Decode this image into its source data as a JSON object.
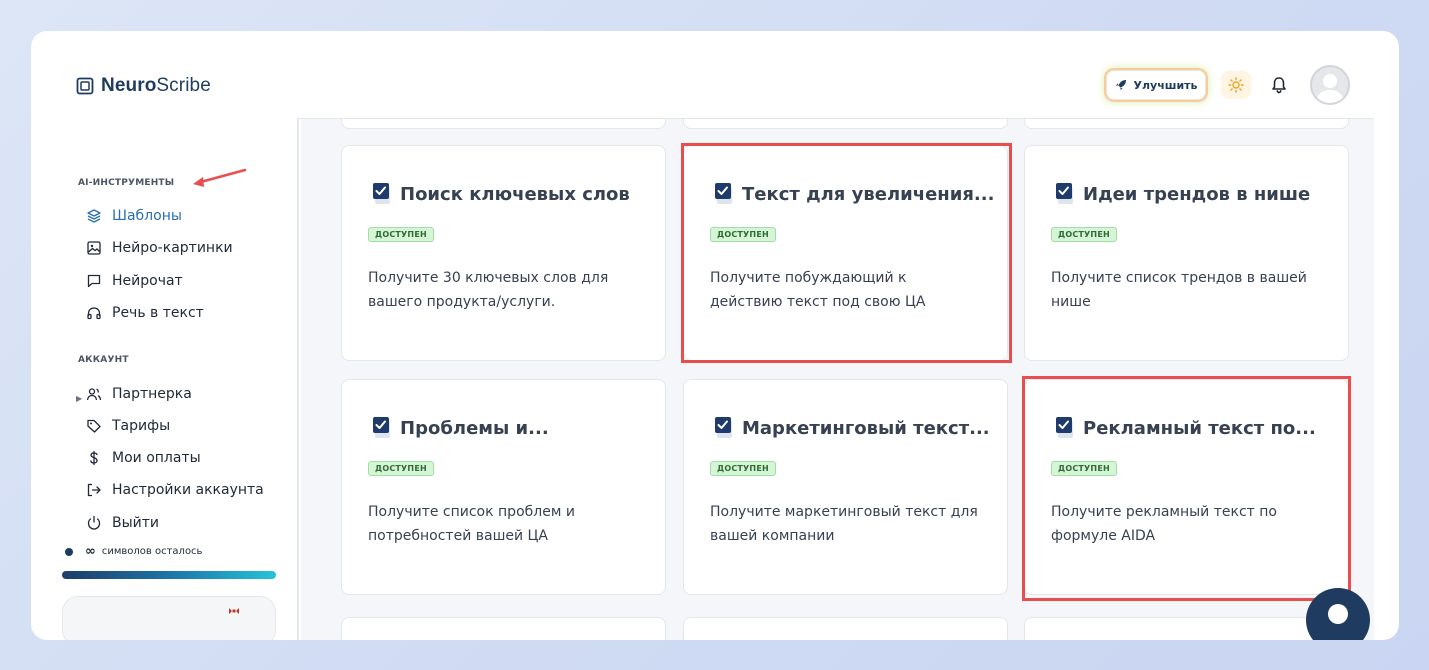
{
  "header": {
    "logo_bold": "Neuro",
    "logo_light": "Scribe",
    "upgrade_label": "Улучшить"
  },
  "sidebar": {
    "tools_title": "AI-ИНСТРУМЕНТЫ",
    "tools": [
      {
        "label": "Шаблоны",
        "icon": "layers-icon",
        "active": true
      },
      {
        "label": "Нейро-картинки",
        "icon": "image-icon"
      },
      {
        "label": "Нейрочат",
        "icon": "chat-icon"
      },
      {
        "label": "Речь в текст",
        "icon": "headphones-icon"
      }
    ],
    "account_title": "АККАУНТ",
    "account": [
      {
        "label": "Партнерка",
        "icon": "users-icon"
      },
      {
        "label": "Тарифы",
        "icon": "tag-icon"
      },
      {
        "label": "Мои оплаты",
        "icon": "dollar-icon"
      },
      {
        "label": "Настройки аккаунта",
        "icon": "logout-arrow-icon"
      },
      {
        "label": "Выйти",
        "icon": "power-icon"
      }
    ],
    "symbols_value": "∞",
    "symbols_label": "символов осталось",
    "progress": 1.0
  },
  "cards": [
    {
      "title": "Поиск ключевых слов",
      "badge": "ДОСТУПЕН",
      "desc": "Получите 30 ключевых слов для вашего продукта/услуги."
    },
    {
      "title": "Текст для увеличения...",
      "badge": "ДОСТУПЕН",
      "desc": "Получите побуждающий к действию текст под свою ЦА"
    },
    {
      "title": "Идеи трендов в нише",
      "badge": "ДОСТУПЕН",
      "desc": "Получите список трендов в вашей нише"
    },
    {
      "title": "Проблемы и...",
      "badge": "ДОСТУПЕН",
      "desc": "Получите список проблем и потребностей вашей ЦА"
    },
    {
      "title": "Маркетинговый текст...",
      "badge": "ДОСТУПЕН",
      "desc": "Получите маркетинговый текст для вашей компании"
    },
    {
      "title": "Рекламный текст по...",
      "badge": "ДОСТУПЕН",
      "desc": "Получите рекламный текст по формуле AIDA"
    }
  ],
  "colors": {
    "brand": "#1f3b5f",
    "accent": "#2a6fb0",
    "highlight": "#e84e4e",
    "badge_bg": "#d5f5d6"
  }
}
